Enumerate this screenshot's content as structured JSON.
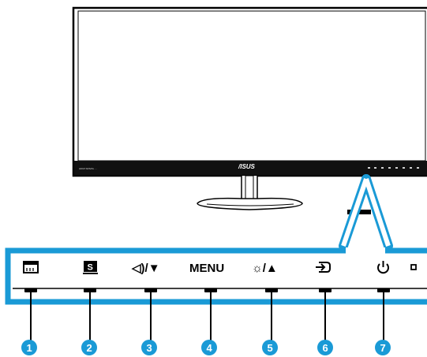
{
  "monitor": {
    "brand_logo": "/ISUS",
    "bezel_text_left": "HDMI  SRS/DL  ..."
  },
  "control_panel": {
    "buttons": [
      {
        "number": "1",
        "icon": "menu-bar-icon",
        "label": ""
      },
      {
        "number": "2",
        "icon": "splendid-icon",
        "label": ""
      },
      {
        "number": "3",
        "icon": "volume-down-icon",
        "label": "◁)/▼"
      },
      {
        "number": "4",
        "icon": "menu-label",
        "label": "MENU"
      },
      {
        "number": "5",
        "icon": "brightness-up-icon",
        "label": "☼/▲"
      },
      {
        "number": "6",
        "icon": "input-select-icon",
        "label": ""
      },
      {
        "number": "7",
        "icon": "power-icon",
        "label": ""
      }
    ],
    "indicator": "power-indicator-light"
  },
  "colors": {
    "accent_blue": "#1a9ad6",
    "callout_blue": "#1a9ad6",
    "outline": "#000000"
  }
}
